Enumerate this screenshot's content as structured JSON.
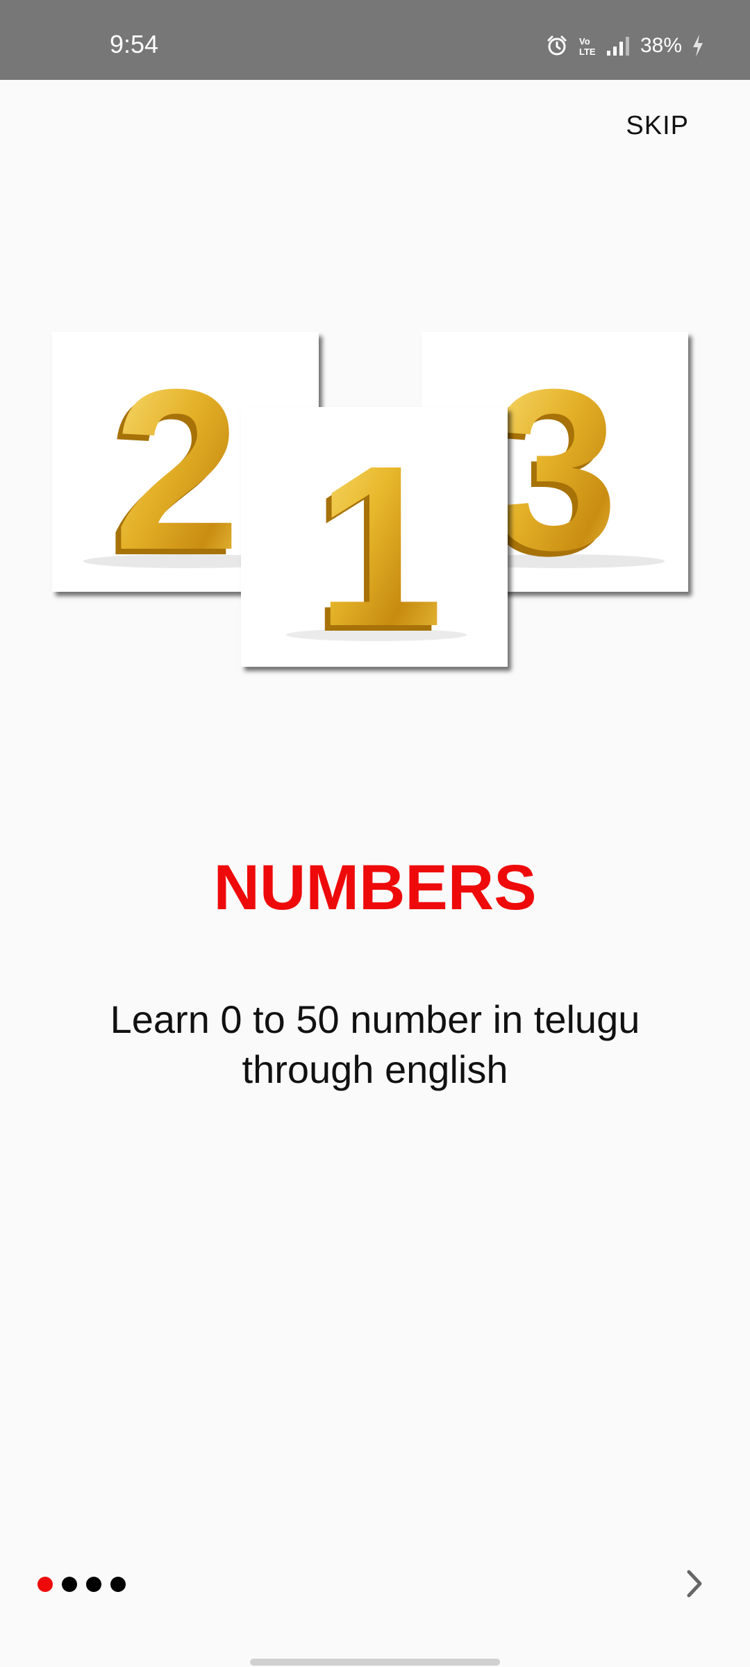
{
  "status_bar": {
    "time": "9:54",
    "battery": "38%",
    "icons": [
      "alarm-icon",
      "volte-icon",
      "signal-icon",
      "battery-charging-icon"
    ]
  },
  "skip_label": "SKIP",
  "hero": {
    "cards": [
      {
        "digit": "2"
      },
      {
        "digit": "1"
      },
      {
        "digit": "3"
      }
    ]
  },
  "title": "NUMBERS",
  "description": "Learn 0 to 50 number in telugu through english",
  "pager": {
    "total": 4,
    "active_index": 0
  },
  "next_icon": "chevron-right-icon",
  "colors": {
    "accent": "#ee0a0a",
    "status_bar": "#777777",
    "background": "#fafafa",
    "gold": "#e5b52a"
  }
}
